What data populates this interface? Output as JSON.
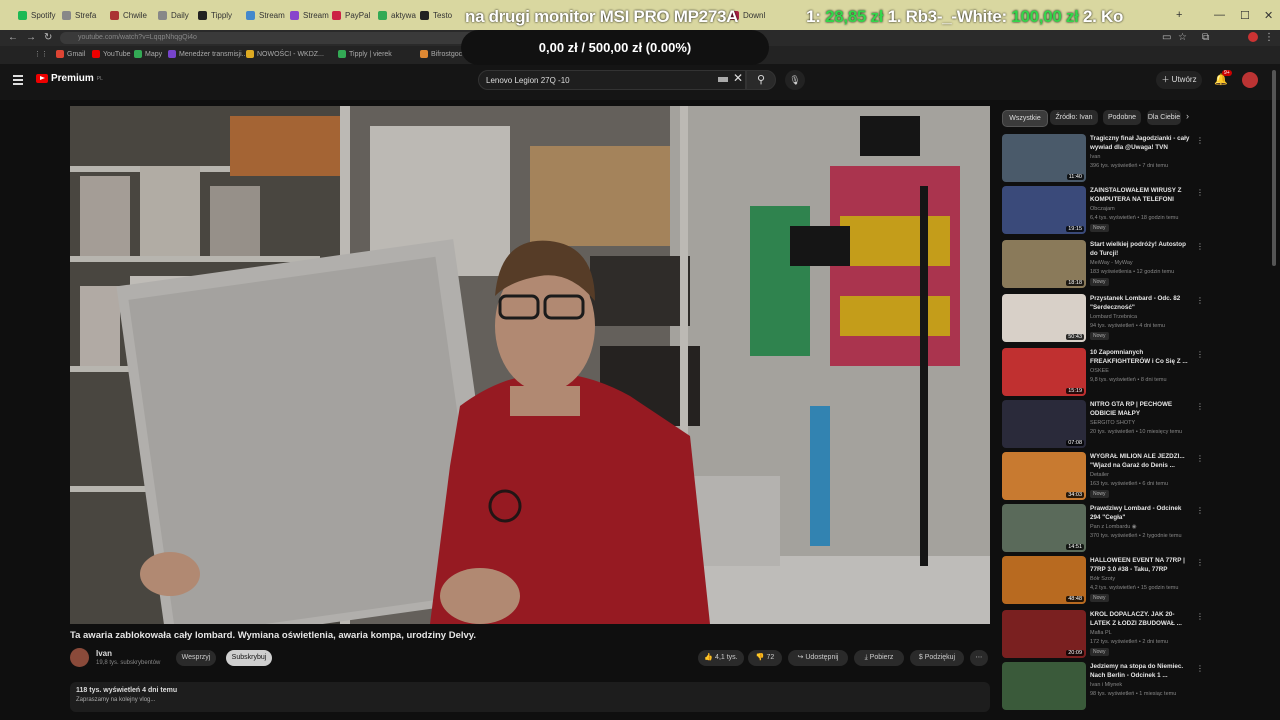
{
  "browser": {
    "tabs": [
      {
        "label": "Spotify",
        "color": "#1db954"
      },
      {
        "label": "Strefa",
        "color": "#888888"
      },
      {
        "label": "Chwile",
        "color": "#aa3333"
      },
      {
        "label": "Daily",
        "color": "#888888"
      },
      {
        "label": "Tipply",
        "color": "#222222"
      },
      {
        "label": "Stream",
        "color": "#4488cc"
      },
      {
        "label": "Stream",
        "color": "#8844cc"
      },
      {
        "label": "PayPal",
        "color": "#cc2244"
      },
      {
        "label": "aktywa",
        "color": "#33aa55"
      },
      {
        "label": "Testo",
        "color": "#222222"
      },
      {
        "label": "Downl",
        "color": "#aa2244"
      }
    ],
    "new_tab": "+",
    "window_controls": {
      "minimize": "—",
      "maximize": "☐",
      "close": "✕"
    },
    "url": "youtube.com/watch?v=LqqpNhqgQi4o",
    "bookmarks": [
      {
        "label": "Gmail",
        "color": "#dd4433"
      },
      {
        "label": "YouTube",
        "color": "#ee0000"
      },
      {
        "label": "Mapy",
        "color": "#33aa55"
      },
      {
        "label": "Menedżer transmisji...",
        "color": "#7744cc"
      },
      {
        "label": "NOWOŚCI - WKDZ...",
        "color": "#ddaa22"
      },
      {
        "label": "Tipply | vierek",
        "color": "#33aa55"
      },
      {
        "label": "Bifrostgoc official site",
        "color": "#dd8833"
      }
    ]
  },
  "overlay": {
    "ticker_prefix": "na drugi monitor MSI PRO MP273A",
    "ticker_mid1": "1:",
    "ticker_green1": "28,85 zł",
    "ticker_mid2": "1. Rb3-_-White:",
    "ticker_green2": "100,00 zł",
    "ticker_suffix": "2. Ko",
    "donation": "0,00 zł / 500,00 zł (0.00%)"
  },
  "header": {
    "logo_text": "Premium",
    "logo_sup": "PL",
    "search_value": "Lenovo Legion 27Q -10",
    "create_label": "Utwórz",
    "notifications_badge": "9+"
  },
  "video": {
    "title": "Ta awaria zablokowała cały lombard. Wymiana oświetlenia, awaria kompa, urodziny Delvy.",
    "channel": "Ivan",
    "subscribers": "19,8 tys. subskrybentów",
    "support_label": "Wesprzyj",
    "subscribe_label": "Subskrybuj",
    "likes": "4,1 tys.",
    "dislikes": "72",
    "share_label": "Udostępnij",
    "download_label": "Pobierz",
    "thanks_label": "Podziękuj",
    "more_label": "⋯",
    "views_line": "118 tys. wyświetleń  4 dni temu",
    "desc_line": "Zapraszamy na kolejny vlog..."
  },
  "chips": [
    "Wszystkie",
    "Źródło: Ivan",
    "Podobne",
    "Dla Ciebie"
  ],
  "recommendations": [
    {
      "title": "Tragiczny finał Jagodzianki - cały wywiad dla @Uwaga! TVN",
      "channel": "Ivan",
      "meta": "396 tys. wyświetleń • 7 dni temu",
      "badge": "",
      "duration": "11:40",
      "thumb": "#4a5a6a"
    },
    {
      "title": "ZAINSTALOWAŁEM WIRUSY Z KOMPUTERA NA TELEFONI",
      "channel": "Obczajam",
      "meta": "6,4 tys. wyświetleń • 18 godzin temu",
      "badge": "Nowy",
      "duration": "19:15",
      "thumb": "#3a4a7a"
    },
    {
      "title": "Start wielkiej podróży! Autostop do Turcji!",
      "channel": "MeiWay - MyWay",
      "meta": "183 wyświetlenia • 12 godzin temu",
      "badge": "Nowy",
      "duration": "18:18",
      "thumb": "#8a7a5a"
    },
    {
      "title": "Przystanek Lombard - Odc. 82 \"Serdeczność\"",
      "channel": "Lombard Trzebnica",
      "meta": "94 tys. wyświetleń • 4 dni temu",
      "badge": "Nowy",
      "duration": "50:43",
      "thumb": "#d8d0c8"
    },
    {
      "title": "10 Zapomnianych FREAKFIGHTERÓW i Co Się Z ...",
      "channel": "OSKEE",
      "meta": "9,8 tys. wyświetleń • 8 dni temu",
      "badge": "",
      "duration": "15:19",
      "thumb": "#c03030"
    },
    {
      "title": "NITRO GTA RP | PECHOWE ODBICIE MAŁPY",
      "channel": "SERGITO SHOTY",
      "meta": "20 tys. wyświetleń • 10 miesięcy temu",
      "badge": "",
      "duration": "07:08",
      "thumb": "#2a2a3a"
    },
    {
      "title": "WYGRAŁ MILION ALE JEŹDZI... \"Wjazd na Garaż do Denis ...",
      "channel": "Detailer",
      "meta": "163 tys. wyświetleń • 6 dni temu",
      "badge": "Nowy",
      "duration": "34:03",
      "thumb": "#c87a30"
    },
    {
      "title": "Prawdziwy Lombard - Odcinek 294 \"Cegła\"",
      "channel": "Pan z Lombardu ◉",
      "meta": "370 tys. wyświetleń • 2 tygodnie temu",
      "badge": "",
      "duration": "14:51",
      "thumb": "#5a6a5a"
    },
    {
      "title": "HALLOWEEN EVENT NA 77RP | 77RP 3.0 #38 - Taku, 77RP",
      "channel": "Bółr Szoty",
      "meta": "4,2 tys. wyświetleń • 15 godzin temu",
      "badge": "Nowy",
      "duration": "48:48",
      "thumb": "#b86a20"
    },
    {
      "title": "KRÓL DOPALACZY. JAK 20-LATEK Z ŁODZI ZBUDOWAŁ ...",
      "channel": "Mafia PL",
      "meta": "172 tys. wyświetleń • 2 dni temu",
      "badge": "Nowy",
      "duration": "20:09",
      "thumb": "#7a2020"
    },
    {
      "title": "Jedziemy na stopa do Niemiec. Nach Berlin - Odcinek 1 ...",
      "channel": "Ivan i Młynek",
      "meta": "98 tys. wyświetleń • 1 miesiąc temu",
      "badge": "",
      "duration": "",
      "thumb": "#3a5a3a"
    }
  ]
}
